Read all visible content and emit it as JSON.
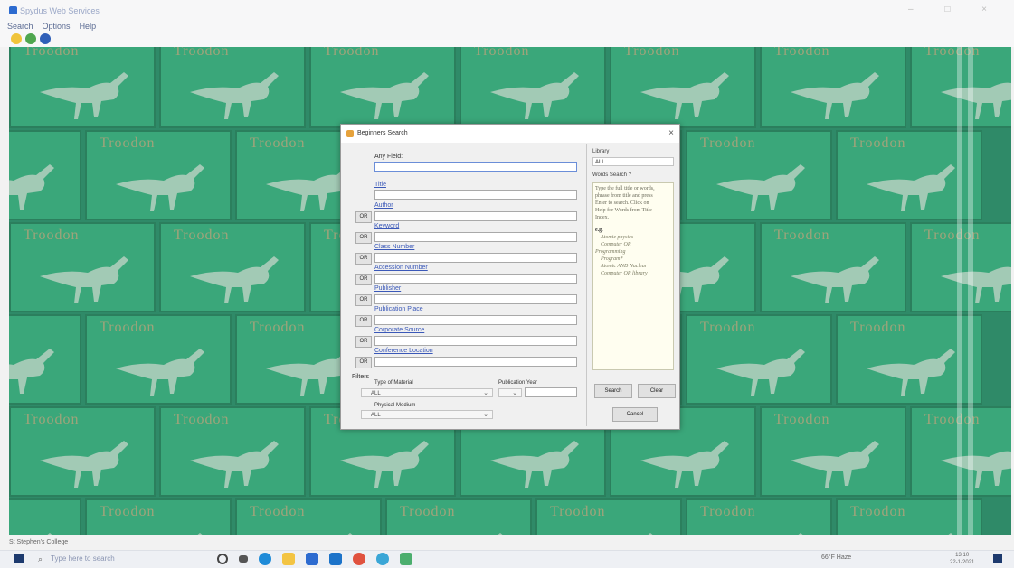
{
  "window": {
    "title": "Spydus Web Services",
    "controls": [
      "–",
      "□",
      "×"
    ]
  },
  "menu": [
    "Search",
    "Options",
    "Help"
  ],
  "toolbar_icons": [
    "search-icon",
    "refresh-icon",
    "help-icon"
  ],
  "background": {
    "logo_text": "Troodon"
  },
  "dialog": {
    "title": "Beginners Search",
    "close": "×",
    "fields": [
      {
        "label": "Any Field:",
        "link": false
      },
      {
        "label": "Title",
        "link": true
      },
      {
        "label": "Author",
        "link": true
      },
      {
        "label": "Keyword",
        "link": true
      },
      {
        "label": "Class Number",
        "link": true
      },
      {
        "label": "Accession Number",
        "link": true
      },
      {
        "label": "Publisher",
        "link": true
      },
      {
        "label": "Publication Place",
        "link": true
      },
      {
        "label": "Corporate Source",
        "link": true
      },
      {
        "label": "Conference Location",
        "link": true
      }
    ],
    "or_label": "OR",
    "filters_label": "Filters",
    "type_of_material": {
      "label": "Type of Material",
      "value": "ALL"
    },
    "physical_medium": {
      "label": "Physical Medium",
      "value": "ALL"
    },
    "publication_year": {
      "label": "Publication Year",
      "value": ""
    },
    "library": {
      "label": "Library",
      "value": "ALL"
    },
    "search_type": "Words Search ?",
    "hint_lines": [
      "Type the full title or words,",
      "phrase from title and press",
      "Enter to search. Click on",
      "Help for Words from Title",
      "Index."
    ],
    "eg_label": "e.g.",
    "examples": [
      "Atomic physics",
      "Computer OR",
      "Programming",
      "Program*",
      "Atomic AND Nuclear",
      "Computer OR library"
    ],
    "buttons": {
      "search": "Search",
      "clear": "Clear",
      "cancel": "Cancel"
    }
  },
  "status": {
    "text": "St Stephen's College"
  },
  "taskbar": {
    "search_placeholder": "Type here to search",
    "apps": [
      "cortana-icon",
      "taskview-icon",
      "edge-icon",
      "explorer-icon",
      "store-icon",
      "mail-icon",
      "chrome-icon",
      "app-icon",
      "app2-icon"
    ],
    "weather": "66°F Haze",
    "time": "13:10",
    "date": "22-1-2021"
  },
  "colors": {
    "bg_green": "#2f8a68",
    "tile_green": "#3aa77a",
    "logo_color": "#d5a27a",
    "link_blue": "#3a58b8",
    "hint_bg": "#fffef0"
  }
}
